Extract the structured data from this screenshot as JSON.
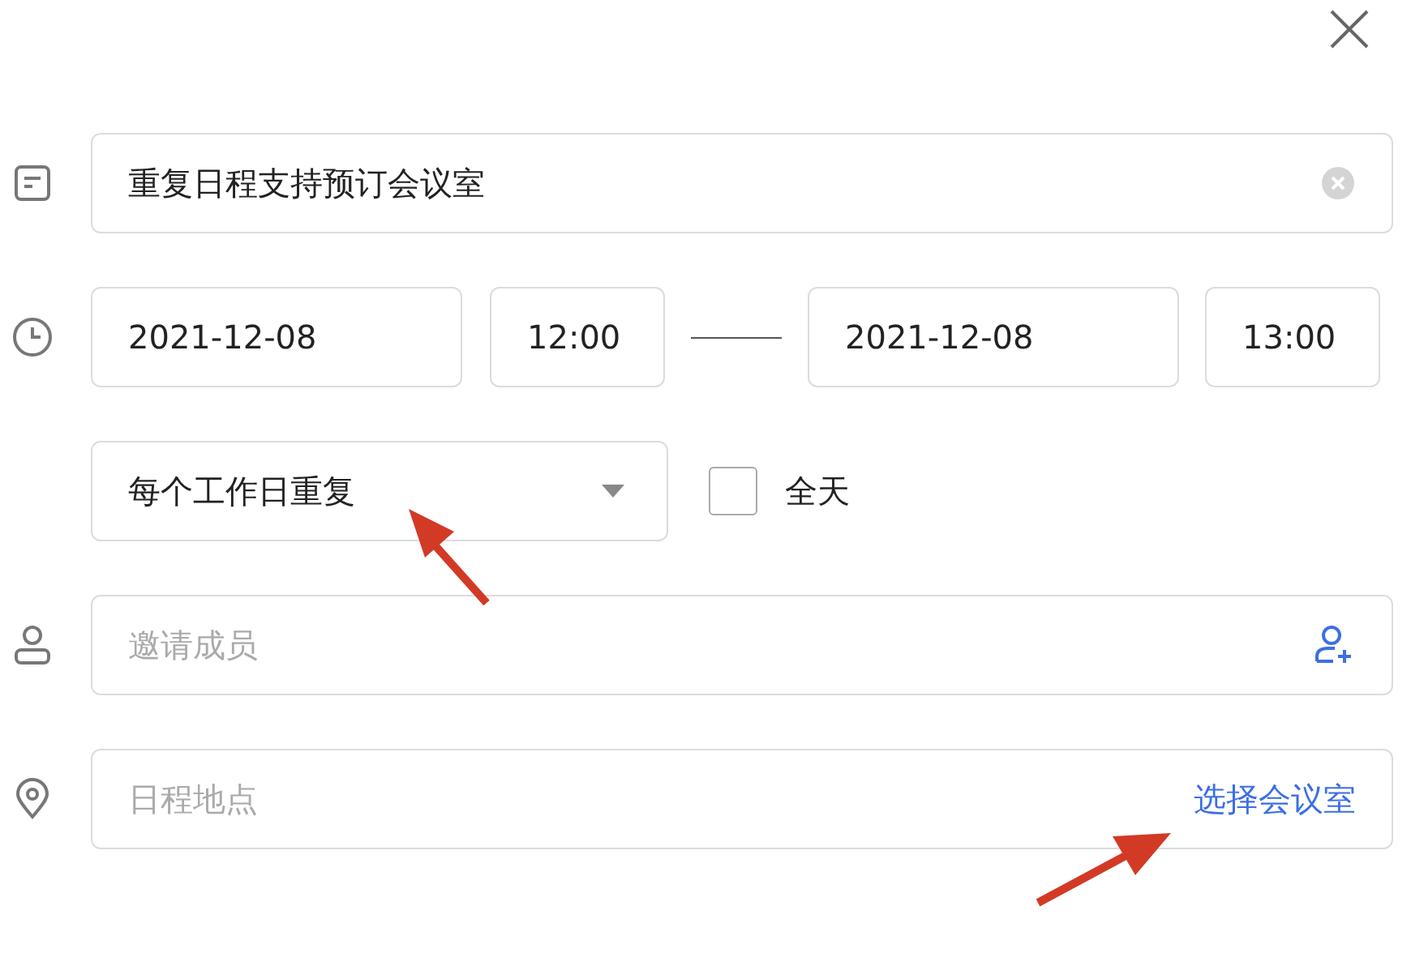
{
  "title_field": {
    "value": "重复日程支持预订会议室"
  },
  "time": {
    "start_date": "2021-12-08",
    "start_time": "12:00",
    "end_date": "2021-12-08",
    "end_time": "13:00"
  },
  "repeat": {
    "value": "每个工作日重复"
  },
  "all_day": {
    "label": "全天",
    "checked": false
  },
  "members": {
    "placeholder": "邀请成员"
  },
  "location": {
    "placeholder": "日程地点",
    "link": "选择会议室"
  }
}
